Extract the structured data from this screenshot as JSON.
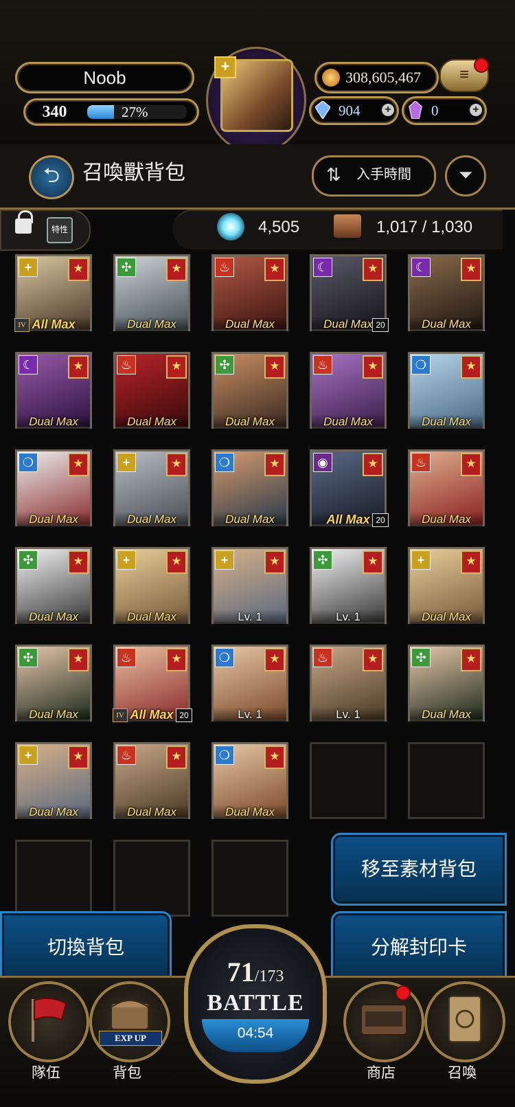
{
  "player": {
    "name": "Noob",
    "level": "340",
    "exp_percent": "27%",
    "exp_fill": 0.27,
    "portrait_element_icon": "plus-icon"
  },
  "currency": {
    "gold": "308,605,467",
    "gems_blue": "904",
    "gems_purple": "0",
    "plus_symbol": "+"
  },
  "menu": {
    "icon": "≡"
  },
  "header": {
    "back_icon": "⮌",
    "title": "召喚獸背包",
    "sort_label": "入手時間",
    "sort_icon": "⇅",
    "filter_icon": "⏷"
  },
  "infobar": {
    "trait_label": "特性",
    "orb_count": "4,505",
    "capacity": "1,017 / 1,030"
  },
  "cards": [
    {
      "element": "light",
      "elem_symbol": "+",
      "label": "All Max",
      "style": "allmax",
      "rank": "IV",
      "lvl": "",
      "color1": "#d9c7a0",
      "color2": "#4a3a2a"
    },
    {
      "element": "wind",
      "elem_symbol": "✣",
      "label": "Dual Max",
      "style": "dual",
      "rank": "",
      "lvl": "",
      "color1": "#cfd3d6",
      "color2": "#445058"
    },
    {
      "element": "fire",
      "elem_symbol": "♨",
      "label": "Dual Max",
      "style": "dual",
      "rank": "",
      "lvl": "",
      "color1": "#b45a45",
      "color2": "#3a1410"
    },
    {
      "element": "dark",
      "elem_symbol": "☾",
      "label": "Dual Max",
      "style": "dual",
      "rank": "",
      "lvl": "20",
      "color1": "#5a5a6a",
      "color2": "#15121a"
    },
    {
      "element": "dark",
      "elem_symbol": "☾",
      "label": "Dual Max",
      "style": "dual",
      "rank": "",
      "lvl": "",
      "color1": "#8a6a4a",
      "color2": "#1e1612"
    },
    {
      "element": "dark",
      "elem_symbol": "☾",
      "label": "Dual Max",
      "style": "dual",
      "rank": "",
      "lvl": "",
      "color1": "#9a5aa8",
      "color2": "#2a1240"
    },
    {
      "element": "fire",
      "elem_symbol": "♨",
      "label": "Dual Max",
      "style": "dual",
      "rank": "",
      "lvl": "",
      "color1": "#b8242a",
      "color2": "#3a0a0a"
    },
    {
      "element": "wind",
      "elem_symbol": "✣",
      "label": "Dual Max",
      "style": "dual",
      "rank": "",
      "lvl": "",
      "color1": "#c98e62",
      "color2": "#3a2a22"
    },
    {
      "element": "fire",
      "elem_symbol": "♨",
      "label": "Dual Max",
      "style": "dual",
      "rank": "",
      "lvl": "",
      "color1": "#a873c4",
      "color2": "#3a1e4a"
    },
    {
      "element": "water",
      "elem_symbol": "❍",
      "label": "Dual Max",
      "style": "dual",
      "rank": "",
      "lvl": "",
      "color1": "#b8d6ea",
      "color2": "#4a6a86"
    },
    {
      "element": "water",
      "elem_symbol": "❍",
      "label": "Dual Max",
      "style": "dual",
      "rank": "",
      "lvl": "",
      "color1": "#eeeeee",
      "color2": "#8a3030"
    },
    {
      "element": "light",
      "elem_symbol": "+",
      "label": "Dual Max",
      "style": "dual",
      "rank": "",
      "lvl": "",
      "color1": "#b9bec4",
      "color2": "#4a4e56"
    },
    {
      "element": "water",
      "elem_symbol": "❍",
      "label": "Dual Max",
      "style": "dual",
      "rank": "",
      "lvl": "",
      "color1": "#d69a6e",
      "color2": "#2a3a4a"
    },
    {
      "element": "void",
      "elem_symbol": "◉",
      "label": "All Max",
      "style": "allmax",
      "rank": "",
      "lvl": "20",
      "color1": "#5a6a86",
      "color2": "#181c26"
    },
    {
      "element": "fire",
      "elem_symbol": "♨",
      "label": "Dual Max",
      "style": "dual",
      "rank": "",
      "lvl": "",
      "color1": "#e0b090",
      "color2": "#8a2020"
    },
    {
      "element": "wind",
      "elem_symbol": "✣",
      "label": "Dual Max",
      "style": "dual",
      "rank": "",
      "lvl": "",
      "color1": "#f2f2f2",
      "color2": "#3a3a3a"
    },
    {
      "element": "light",
      "elem_symbol": "+",
      "label": "Dual Max",
      "style": "dual",
      "rank": "",
      "lvl": "",
      "color1": "#e8cf9a",
      "color2": "#7a5a3a"
    },
    {
      "element": "light",
      "elem_symbol": "+",
      "label": "Lv. 1",
      "style": "lv",
      "rank": "",
      "lvl": "",
      "color1": "#d8b088",
      "color2": "#5a6a80"
    },
    {
      "element": "wind",
      "elem_symbol": "✣",
      "label": "Lv. 1",
      "style": "lv",
      "rank": "",
      "lvl": "",
      "color1": "#f2f2f2",
      "color2": "#3a3a3a"
    },
    {
      "element": "light",
      "elem_symbol": "+",
      "label": "Dual Max",
      "style": "dual",
      "rank": "",
      "lvl": "",
      "color1": "#e8cf9a",
      "color2": "#7a5a3a"
    },
    {
      "element": "wind",
      "elem_symbol": "✣",
      "label": "Dual Max",
      "style": "dual",
      "rank": "",
      "lvl": "",
      "color1": "#e6c8aa",
      "color2": "#1e2a1e"
    },
    {
      "element": "fire",
      "elem_symbol": "♨",
      "label": "All Max",
      "style": "allmax",
      "rank": "IV",
      "lvl": "20",
      "color1": "#e8c0a0",
      "color2": "#8a2a2a"
    },
    {
      "element": "water",
      "elem_symbol": "❍",
      "label": "Lv. 1",
      "style": "lv",
      "rank": "",
      "lvl": "",
      "color1": "#e8c8a8",
      "color2": "#7a4a2a"
    },
    {
      "element": "fire",
      "elem_symbol": "♨",
      "label": "Lv. 1",
      "style": "lv",
      "rank": "",
      "lvl": "",
      "color1": "#c8a888",
      "color2": "#4a3a26"
    },
    {
      "element": "wind",
      "elem_symbol": "✣",
      "label": "Dual Max",
      "style": "dual",
      "rank": "",
      "lvl": "",
      "color1": "#e6c8aa",
      "color2": "#1e2a1e"
    },
    {
      "element": "light",
      "elem_symbol": "+",
      "label": "Dual Max",
      "style": "dual",
      "rank": "",
      "lvl": "",
      "color1": "#d8b088",
      "color2": "#5a6a80"
    },
    {
      "element": "fire",
      "elem_symbol": "♨",
      "label": "Dual Max",
      "style": "dual",
      "rank": "",
      "lvl": "",
      "color1": "#c8a888",
      "color2": "#4a3a26"
    },
    {
      "element": "water",
      "elem_symbol": "❍",
      "label": "Dual Max",
      "style": "dual",
      "rank": "",
      "lvl": "",
      "color1": "#e8c8a8",
      "color2": "#7a4a2a"
    }
  ],
  "actions": {
    "move_to_material": "移至素材背包",
    "switch_bag": "切換背包",
    "disassemble": "分解封印卡"
  },
  "nav": {
    "team": "隊伍",
    "bag": "背包",
    "bag_badge": "EXP UP",
    "shop": "商店",
    "summon": "召喚"
  },
  "battle": {
    "current": "71",
    "max": "/173",
    "label": "BATTLE",
    "timer": "04:54"
  },
  "colors": {
    "accent_gold": "#b8944e",
    "action_blue": "#0c4f86",
    "star_red": "#b41e1e",
    "notification_red": "#e8141c"
  }
}
